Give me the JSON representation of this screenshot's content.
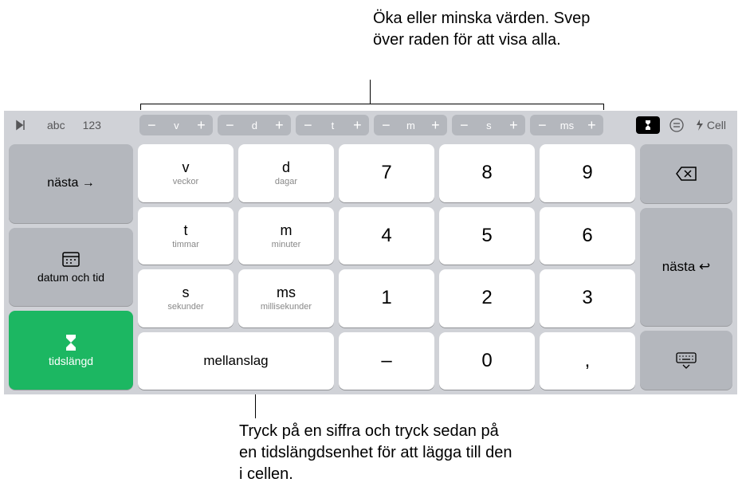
{
  "annotations": {
    "top": "Öka eller minska värden. Svep över raden för att visa alla.",
    "bottom": "Tryck på en siffra och tryck sedan på en tidslängdsenhet för att lägga till den i cellen."
  },
  "topbar": {
    "abc": "abc",
    "num": "123",
    "cell": "Cell",
    "steppers": [
      {
        "label": "v"
      },
      {
        "label": "d"
      },
      {
        "label": "t"
      },
      {
        "label": "m"
      },
      {
        "label": "s"
      },
      {
        "label": "ms"
      }
    ]
  },
  "left": {
    "next": "nästa →",
    "datetime": "datum och tid",
    "duration": "tidslängd"
  },
  "units": [
    {
      "symbol": "v",
      "name": "veckor"
    },
    {
      "symbol": "d",
      "name": "dagar"
    },
    {
      "symbol": "t",
      "name": "timmar"
    },
    {
      "symbol": "m",
      "name": "minuter"
    },
    {
      "symbol": "s",
      "name": "sekunder"
    },
    {
      "symbol": "ms",
      "name": "millisekunder"
    }
  ],
  "digits": {
    "7": "7",
    "8": "8",
    "9": "9",
    "4": "4",
    "5": "5",
    "6": "6",
    "1": "1",
    "2": "2",
    "3": "3",
    "0": "0",
    "minus": "–",
    "comma": ","
  },
  "space": "mellanslag",
  "right": {
    "next": "nästa ↩︎"
  }
}
